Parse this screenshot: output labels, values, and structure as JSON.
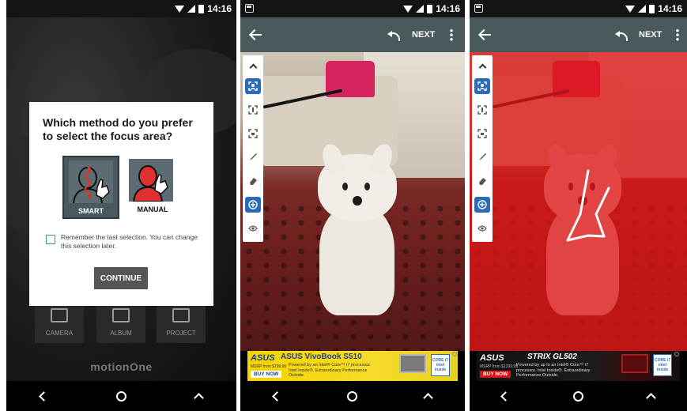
{
  "status": {
    "time": "14:16"
  },
  "panel1": {
    "dialog": {
      "title": "Which method do you prefer to select the focus area?",
      "option_smart": "SMART",
      "option_manual": "MANUAL",
      "remember_text": "Remember the last selection. You can change this selection later.",
      "continue_label": "CONTINUE"
    },
    "home": {
      "camera": "CAMERA",
      "album": "ALBUM",
      "project": "PROJECT"
    },
    "logo": "motionOne"
  },
  "toolbar": {
    "next_label": "NEXT"
  },
  "tools": [
    "chevron-up-icon",
    "smart-select-icon",
    "magic-select-icon",
    "crop-select-icon",
    "brush-icon",
    "eraser-icon",
    "zoom-icon",
    "preview-icon"
  ],
  "ad_vivobook": {
    "brand": "ASUS",
    "model": "ASUS VivoBook S510",
    "desc": "Powered by an Intel® Core™ i7 processor. Intel Inside®. Extraordinary Performance Outside.",
    "price": "MSRP from $799.99",
    "cta": "BUY NOW",
    "intel": "CORE i7 intel inside"
  },
  "ad_strix": {
    "brand": "ASUS",
    "model": "STRIX GL502",
    "desc": "Powered by up to an Intel® Core™ i7 processor. Intel Inside®. Extraordinary Performance Outside.",
    "price": "MSRP from $1299.99",
    "cta": "BUY NOW",
    "intel": "CORE i7 intel inside"
  },
  "colors": {
    "toolbar": "#4a5a5c",
    "mask": "#de1616",
    "active_tool": "#2c6bb7",
    "checkbox": "#2fa7a0"
  }
}
